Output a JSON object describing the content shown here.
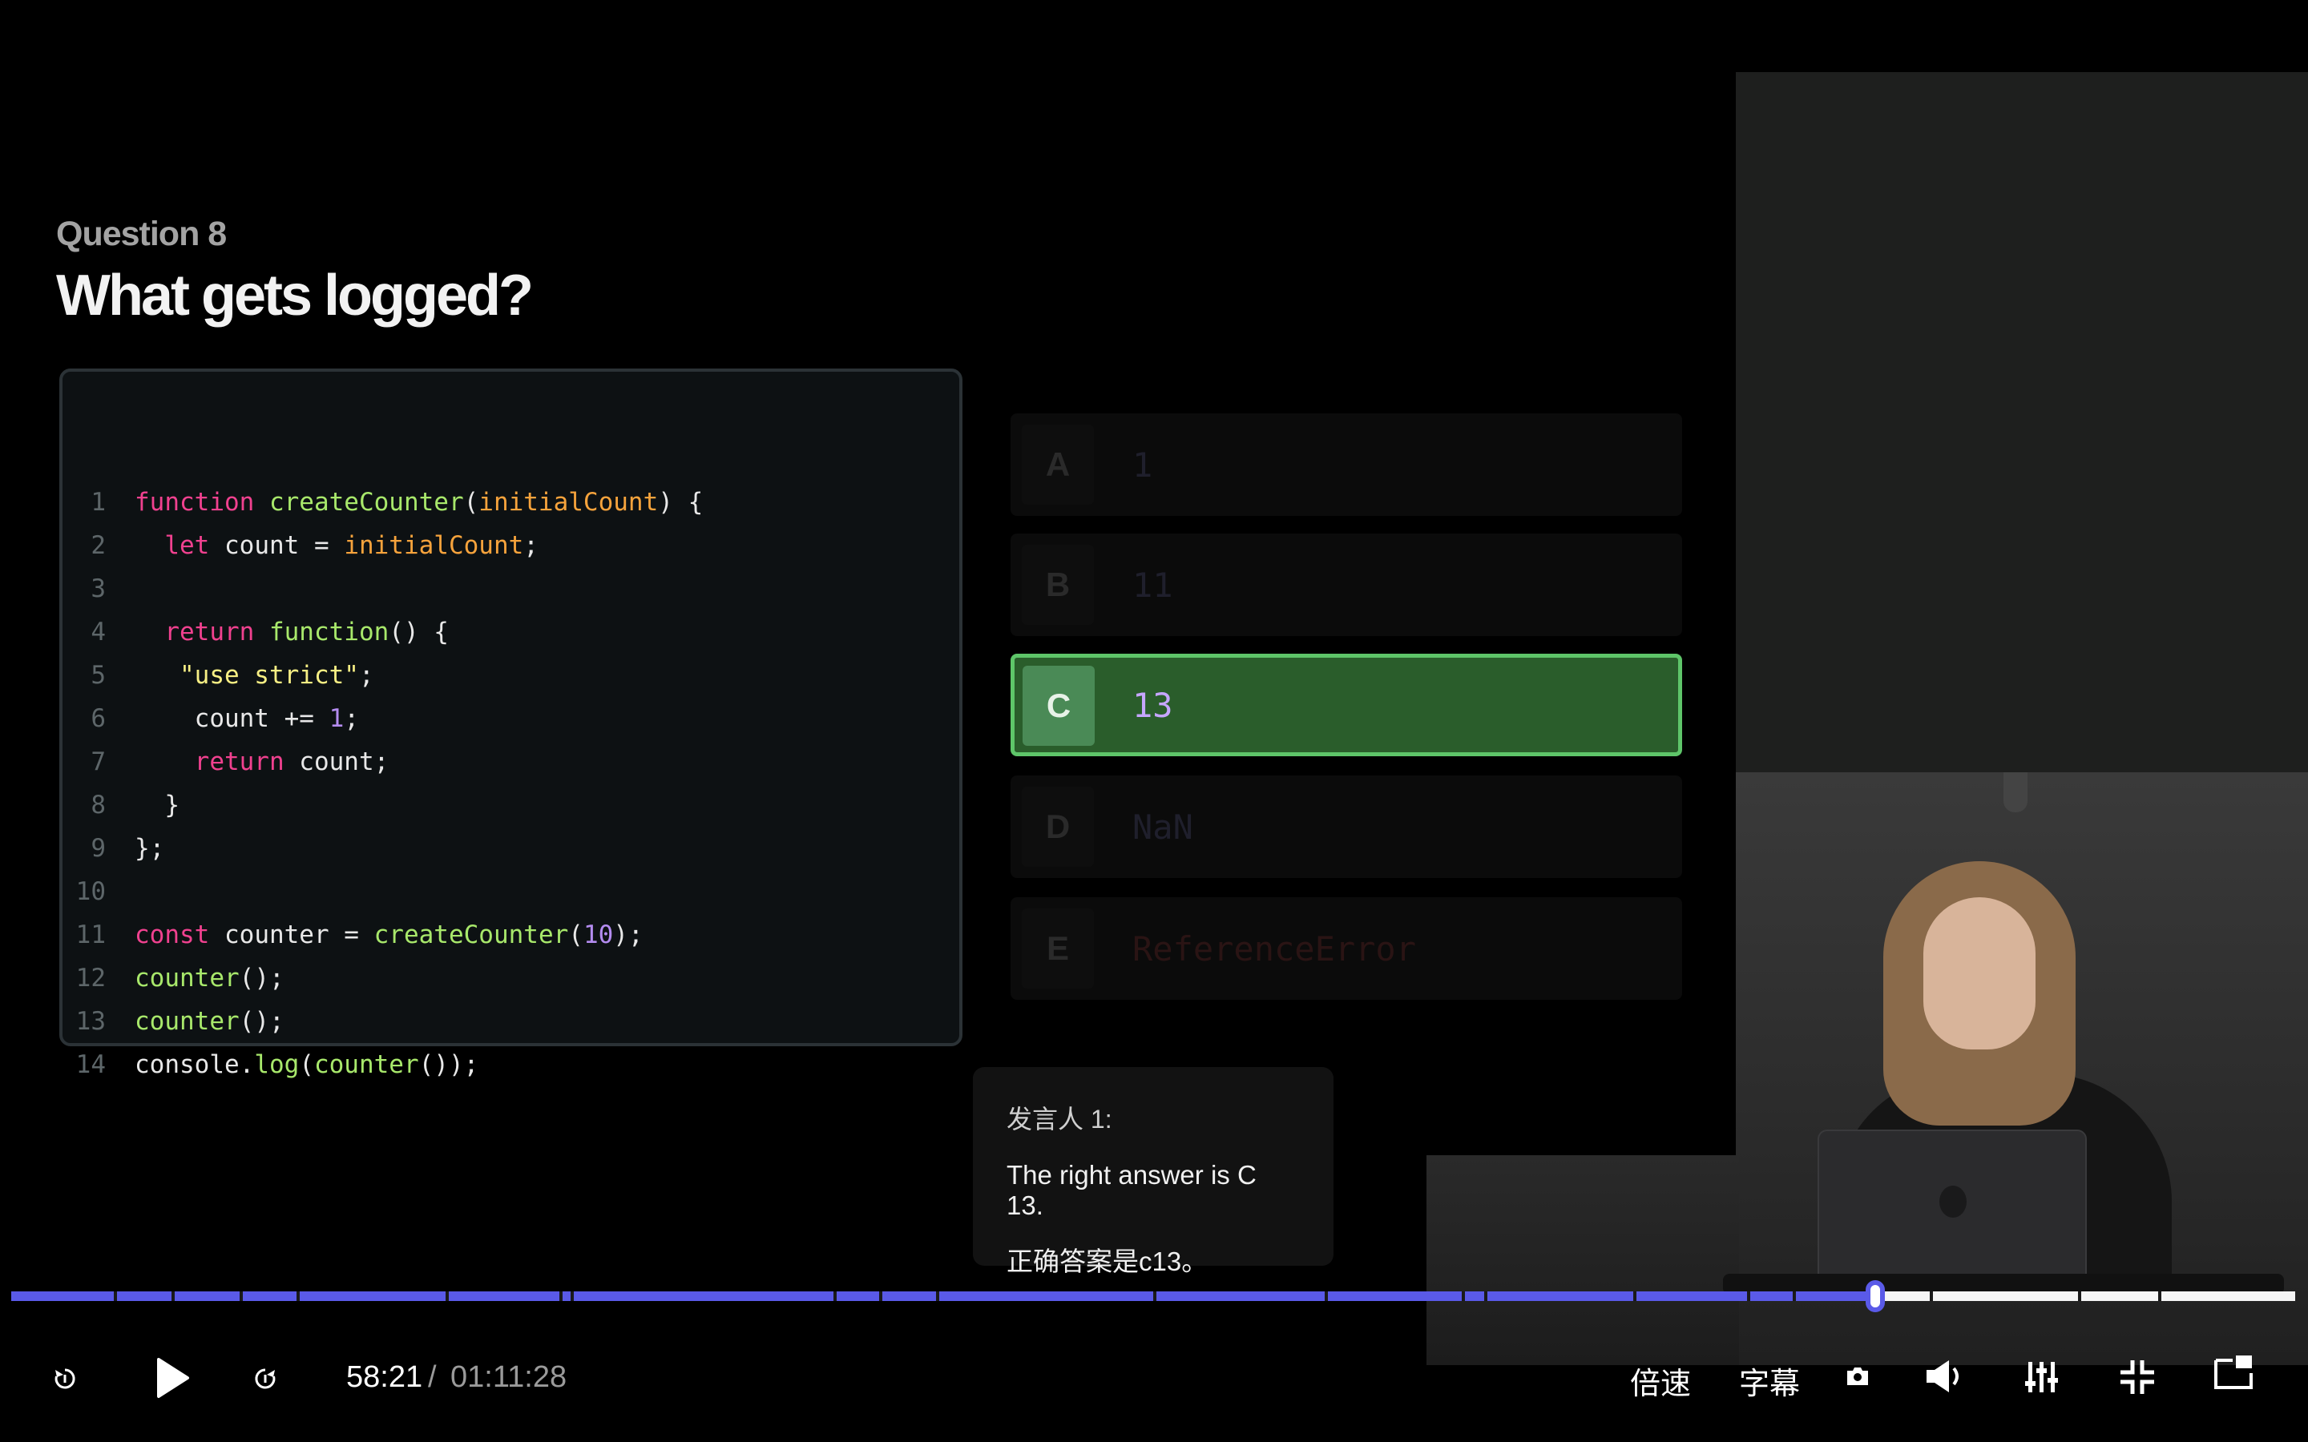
{
  "slide": {
    "question_label": "Question 8",
    "question_title": "What gets logged?",
    "code_lines": [
      {
        "n": "1"
      },
      {
        "n": "2"
      },
      {
        "n": "3"
      },
      {
        "n": "4"
      },
      {
        "n": "5"
      },
      {
        "n": "6"
      },
      {
        "n": "7"
      },
      {
        "n": "8"
      },
      {
        "n": "9"
      },
      {
        "n": "10"
      },
      {
        "n": "11"
      },
      {
        "n": "12"
      },
      {
        "n": "13"
      },
      {
        "n": "14"
      }
    ],
    "code": {
      "l1": {
        "kw": "function",
        "fn": " createCounter",
        "p1": "(",
        "par": "initialCount",
        "p2": ") {"
      },
      "l2": {
        "kw": "  let",
        "t": " count = ",
        "par": "initialCount",
        "p": ";"
      },
      "l4": {
        "kw": "  return",
        "fn": " function",
        "p": "() {"
      },
      "l5": {
        "str": "   \"use strict\"",
        "p": ";"
      },
      "l6": {
        "t": "    count += ",
        "num": "1",
        "p": ";"
      },
      "l7": {
        "kw": "    return",
        "t": " count;"
      },
      "l8": {
        "p": "  }"
      },
      "l9": {
        "p": "};"
      },
      "l11": {
        "kw": "const",
        "t": " counter = ",
        "fn": "createCounter",
        "p1": "(",
        "num": "10",
        "p2": ");"
      },
      "l12": {
        "fn": "counter",
        "p": "();"
      },
      "l13": {
        "fn": "counter",
        "p": "();"
      },
      "l14": {
        "t": "console.",
        "fn1": "log",
        "p1": "(",
        "fn2": "counter",
        "p2": "());"
      }
    },
    "options": [
      {
        "letter": "A",
        "value": "1"
      },
      {
        "letter": "B",
        "value": "11"
      },
      {
        "letter": "C",
        "value": "13",
        "selected": true
      },
      {
        "letter": "D",
        "value": "NaN"
      },
      {
        "letter": "E",
        "value": "ReferenceError"
      }
    ],
    "colors": {
      "correct_bg": "#2a5d2b",
      "correct_border": "#5ec569",
      "keyword": "#f0418f",
      "function": "#a8e86b",
      "param": "#f6a33c",
      "string": "#f7ef84",
      "number": "#b48cf0"
    }
  },
  "subtitle": {
    "speaker": "发言人 1:",
    "english": "The right answer is C 13.",
    "chinese": "正确答案是c13。"
  },
  "player": {
    "current_time": "58:21",
    "separator": "/",
    "total_time": "01:11:28",
    "progress_fraction": 0.8163,
    "accent_color": "#5a5ae8",
    "speed_label": "倍速",
    "captions_label": "字幕",
    "icons": [
      "rewind-icon",
      "play-icon",
      "forward-icon",
      "screenshot-icon",
      "volume-icon",
      "equalizer-icon",
      "exit-fullscreen-icon",
      "picture-in-picture-icon"
    ]
  }
}
